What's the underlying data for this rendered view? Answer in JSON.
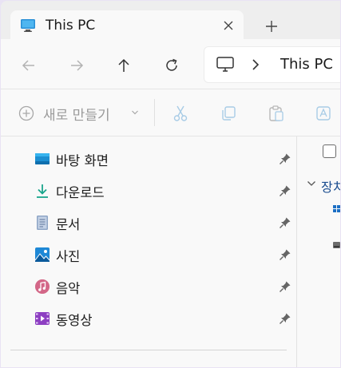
{
  "tab": {
    "title": "This PC"
  },
  "address": {
    "location": "This PC"
  },
  "toolbar": {
    "new_label": "새로 만들기"
  },
  "sidebar": {
    "items": [
      {
        "label": "바탕 화면",
        "icon": "desktop-icon"
      },
      {
        "label": "다운로드",
        "icon": "download-icon"
      },
      {
        "label": "문서",
        "icon": "document-icon"
      },
      {
        "label": "사진",
        "icon": "pictures-icon"
      },
      {
        "label": "음악",
        "icon": "music-icon"
      },
      {
        "label": "동영상",
        "icon": "videos-icon"
      }
    ]
  },
  "content": {
    "group_label": "장치"
  },
  "colors": {
    "accent": "#0067c0",
    "window_bg": "#f9f9f9",
    "tab_strip": "#eeeeee"
  }
}
